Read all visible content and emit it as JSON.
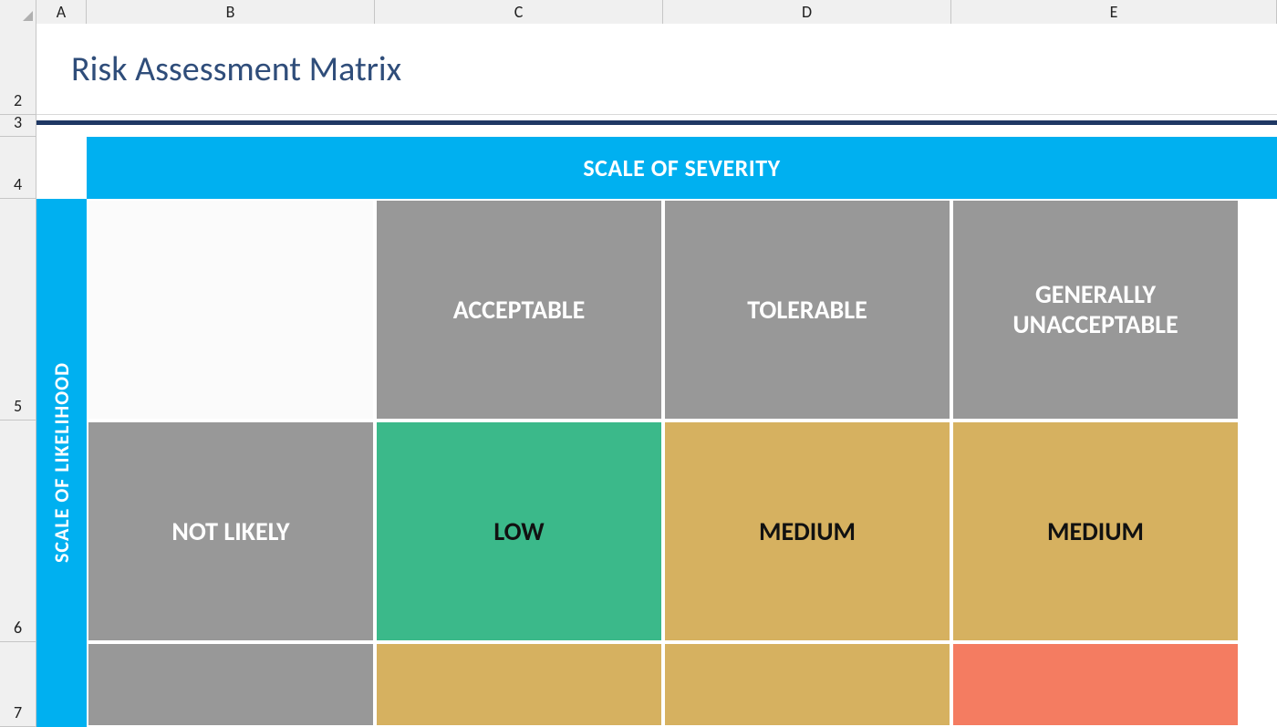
{
  "columns": {
    "A": "A",
    "B": "B",
    "C": "C",
    "D": "D",
    "E": "E"
  },
  "rows": {
    "r2": "2",
    "r3": "3",
    "r4": "4",
    "r5": "5",
    "r6": "6",
    "r7": "7"
  },
  "title": "Risk Assessment Matrix",
  "headers": {
    "severity": "SCALE OF SEVERITY",
    "likelihood": "SCALE OF LIKELIHOOD"
  },
  "matrix": {
    "row5": {
      "B": "",
      "C": "ACCEPTABLE",
      "D": "TOLERABLE",
      "E": "GENERALLY UNACCEPTABLE"
    },
    "row6": {
      "B": "NOT LIKELY",
      "C": "LOW",
      "D": "MEDIUM",
      "E": "MEDIUM"
    },
    "row7": {
      "B": "",
      "C": "",
      "D": "",
      "E": ""
    }
  },
  "colors": {
    "accent": "#00b0f0",
    "titleText": "#2f4d7a",
    "rule": "#1f3864",
    "gray": "#989898",
    "green": "#3bb98a",
    "tan": "#d6b160",
    "salmon": "#f47c61"
  }
}
